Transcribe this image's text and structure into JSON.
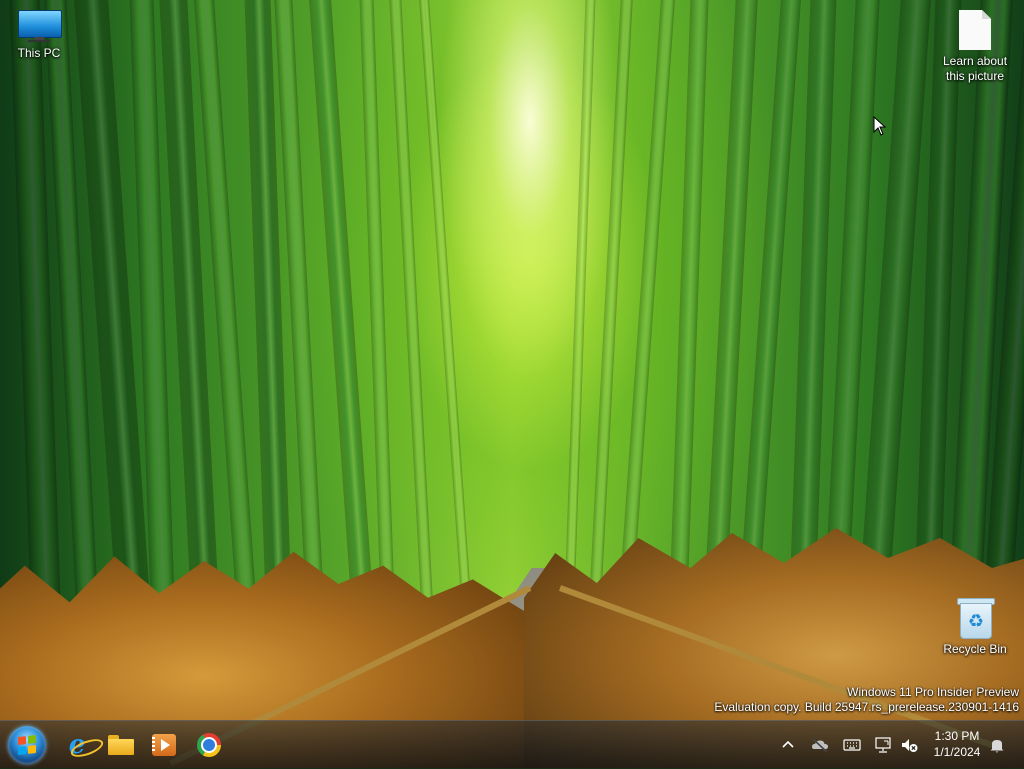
{
  "desktop": {
    "icons": [
      {
        "label": "This PC"
      },
      {
        "label": "Learn about this picture"
      },
      {
        "label": "Recycle Bin"
      }
    ]
  },
  "watermark": {
    "line1": "Windows 11 Pro Insider Preview",
    "line2": "Evaluation copy. Build 25947.rs_prerelease.230901-1416"
  },
  "taskbar": {
    "pinned": [
      {
        "icon": "start-orb-icon"
      },
      {
        "icon": "internet-explorer-icon"
      },
      {
        "icon": "file-explorer-icon"
      },
      {
        "icon": "media-player-icon"
      },
      {
        "icon": "chrome-icon"
      }
    ],
    "tray_icons": [
      "chevron-up-icon",
      "onedrive-offline-icon",
      "keyboard-icon",
      "network-icon",
      "volume-muted-icon",
      "notification-bell-icon"
    ],
    "clock": {
      "time": "1:30 PM",
      "date": "1/1/2024"
    }
  }
}
